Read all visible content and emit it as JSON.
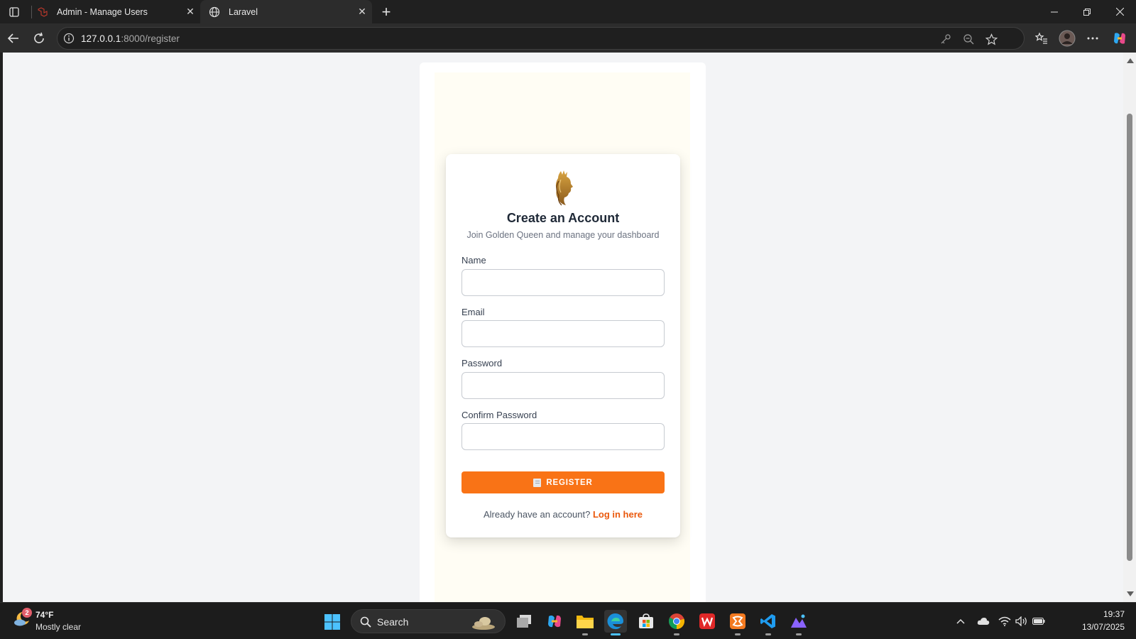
{
  "browser": {
    "tabs": [
      {
        "title": "Admin - Manage Users",
        "active": false
      },
      {
        "title": "Laravel",
        "active": true
      }
    ],
    "address": {
      "host": "127.0.0.1",
      "rest": ":8000/register"
    }
  },
  "page": {
    "title": "Create an Account",
    "subtitle": "Join Golden Queen and manage your dashboard",
    "fields": {
      "name": {
        "label": "Name",
        "value": ""
      },
      "email": {
        "label": "Email",
        "value": ""
      },
      "password": {
        "label": "Password",
        "value": ""
      },
      "confirm": {
        "label": "Confirm Password",
        "value": ""
      }
    },
    "register_button": "REGISTER",
    "login_prompt": "Already have an account?",
    "login_link": "Log in here",
    "colors": {
      "accent": "#f97316",
      "link": "#ea580c",
      "logo": "#b8860b"
    }
  },
  "taskbar": {
    "weather": {
      "temp": "74°F",
      "desc": "Mostly clear",
      "badge": "2"
    },
    "search_label": "Search",
    "clock": {
      "time": "19:37",
      "date": "13/07/2025"
    }
  }
}
